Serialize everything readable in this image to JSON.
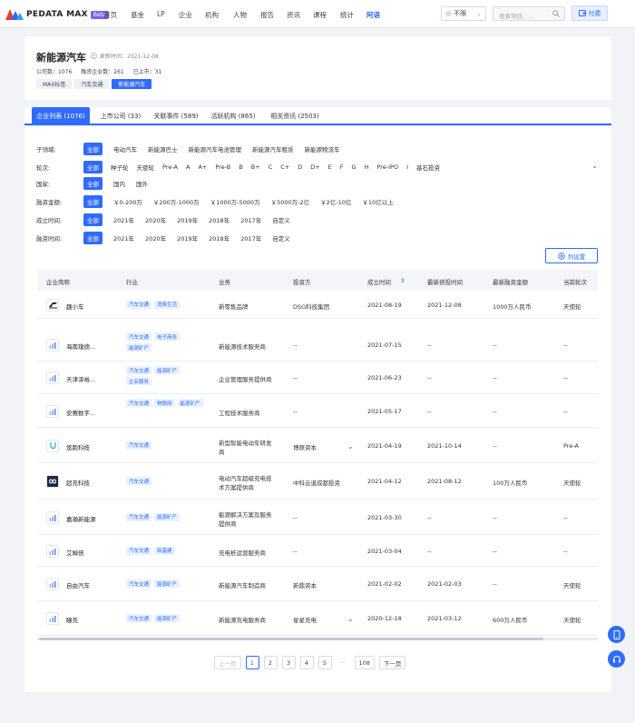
{
  "brand": {
    "name": "PEDATA MAX",
    "badge": "Beta"
  },
  "nav": [
    "首页",
    "基金",
    "LP",
    "企业",
    "机构",
    "人物",
    "报告",
    "资讯",
    "课程",
    "统计",
    "阿语"
  ],
  "region": "不限",
  "search_placeholder": "搜索项目、...",
  "pay_label": "付费",
  "header": {
    "title": "新能源汽车",
    "updated_label": "更新时间：2021-12-08",
    "stats": [
      "公司数：1076",
      "融资企业数：261",
      "已上市：31"
    ],
    "crumbs": [
      "MAX标签",
      "汽车交通",
      "新能源汽车"
    ]
  },
  "tabs": [
    "企业列表 (1076)",
    "上市公司 (33)",
    "关联事件 (589)",
    "活跃机构 (865)",
    "相关资讯 (2503)"
  ],
  "filters": [
    {
      "label": "子领域:",
      "options": [
        "全部",
        "电动汽车",
        "新能源巴士",
        "新能源汽车电池管理",
        "新能源汽车租赁",
        "新能源物流车"
      ]
    },
    {
      "label": "轮次:",
      "options": [
        "全部",
        "种子轮",
        "天使轮",
        "Pre-A",
        "A",
        "A+",
        "Pre-B",
        "B",
        "B+",
        "C",
        "C+",
        "D",
        "D+",
        "E",
        "F",
        "G",
        "H",
        "Pre-IPO",
        "I",
        "基石投资"
      ]
    },
    {
      "label": "国家:",
      "options": [
        "全部",
        "国内",
        "国外"
      ]
    },
    {
      "label": "融资金额:",
      "options": [
        "全部",
        "￥0-200万",
        "￥200万-1000万",
        "￥1000万-5000万",
        "￥5000万-2亿",
        "￥2亿-10亿",
        "￥10亿以上"
      ]
    },
    {
      "label": "成立时间:",
      "options": [
        "全部",
        "2021年",
        "2020年",
        "2019年",
        "2018年",
        "2017年",
        "自定义"
      ]
    },
    {
      "label": "融资时间:",
      "options": [
        "全部",
        "2021年",
        "2020年",
        "2019年",
        "2018年",
        "2017年",
        "自定义"
      ]
    }
  ],
  "column_settings": "列设置",
  "columns": [
    "企业简称",
    "行业",
    "业务",
    "投资方",
    "成立时间",
    "最新获投时间",
    "最新融资金额",
    "当前轮次"
  ],
  "rows": [
    {
      "name": "趣小车",
      "tags": [
        "汽车交通",
        "消费生活"
      ],
      "biz": [
        "新零售品牌"
      ],
      "inv": "DSG科技集团",
      "est": "2021-08-19",
      "last": "2021-12-08",
      "amt": "1000万人民币",
      "round": "天使轮"
    },
    {
      "name": "海南璞德...",
      "tags": [
        "汽车交通",
        "电子商务",
        "能源矿产"
      ],
      "biz": [
        "新能源技术服务商"
      ],
      "inv": "--",
      "est": "2021-07-15",
      "last": "--",
      "amt": "--",
      "round": "--"
    },
    {
      "name": "天津泽裕...",
      "tags": [
        "汽车交通",
        "能源矿产",
        "企业服务"
      ],
      "biz": [
        "企业管理服务提供商"
      ],
      "inv": "--",
      "est": "2021-06-23",
      "last": "--",
      "amt": "--",
      "round": "--"
    },
    {
      "name": "安赛数字...",
      "tags": [
        "汽车交通",
        "物联网",
        "能源矿产"
      ],
      "biz": [
        "工程技术服务商"
      ],
      "inv": "--",
      "est": "2021-05-17",
      "last": "--",
      "amt": "--",
      "round": "--"
    },
    {
      "name": "悠跑科技",
      "tags": [
        "汽车交通"
      ],
      "biz": [
        "新型智能电动车研发",
        "商"
      ],
      "inv": "博原资本",
      "est": "2021-04-19",
      "last": "2021-10-14",
      "amt": "--",
      "round": "Pre-A"
    },
    {
      "name": "超充科技",
      "tags": [
        "汽车交通"
      ],
      "biz": [
        "电动汽车超级充电技",
        "术方案提供商"
      ],
      "inv": "中科云道成都投资",
      "est": "2021-04-12",
      "last": "2021-08-12",
      "amt": "100万人民币",
      "round": "天使轮"
    },
    {
      "name": "嘉瀚新能源",
      "tags": [
        "汽车交通",
        "能源矿产"
      ],
      "biz": [
        "能源解决方案及服务",
        "提供商"
      ],
      "inv": "--",
      "est": "2021-03-30",
      "last": "--",
      "amt": "--",
      "round": "--"
    },
    {
      "name": "艾姆倍",
      "tags": [
        "汽车交通",
        "新基建"
      ],
      "biz": [
        "充电桩运营服务商"
      ],
      "inv": "--",
      "est": "2021-03-04",
      "last": "--",
      "amt": "--",
      "round": "--"
    },
    {
      "name": "自由汽车",
      "tags": [
        "汽车交通",
        "能源矿产"
      ],
      "biz": [
        "新能源汽车制造商"
      ],
      "inv": "新鼎资本",
      "est": "2021-02-02",
      "last": "2021-02-03",
      "amt": "--",
      "round": "天使轮"
    },
    {
      "name": "瞳充",
      "tags": [
        "汽车交通",
        "能源矿产"
      ],
      "biz": [
        "新能源充电服务商"
      ],
      "inv": "星星充电",
      "est": "2020-12-18",
      "last": "2021-03-12",
      "amt": "600万人民币",
      "round": "天使轮"
    }
  ],
  "pager": {
    "prev": "上一页",
    "pages": [
      "1",
      "2",
      "3",
      "4",
      "5"
    ],
    "dots": "···",
    "last": "108",
    "next": "下一页"
  }
}
